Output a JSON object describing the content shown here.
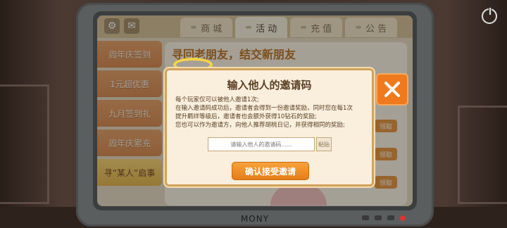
{
  "top_nav": {
    "tabs": [
      {
        "label": "商 城"
      },
      {
        "label": "活 动"
      },
      {
        "label": "充 值"
      },
      {
        "label": "公 告"
      }
    ],
    "ornament": "⇹"
  },
  "sidebar": {
    "items": [
      {
        "label": "周年庆签到"
      },
      {
        "label": "1元超优惠"
      },
      {
        "label": "九月签到礼"
      },
      {
        "label": "周年庆累充"
      },
      {
        "label": "寻“某人”启事"
      }
    ]
  },
  "main": {
    "headline": "寻回老朋友，结交新朋友",
    "mini_buttons": [
      "领取",
      "领取",
      "领取"
    ]
  },
  "dialog": {
    "title": "输入他人的邀请码",
    "body_lines": [
      "每个玩家仅可以被他人邀请1次;",
      "在输入邀请码成功后，邀请者会得到一份邀请奖励，同时您在每1次",
      "提升羁绊等级后，邀请者也会额外获得10钻石的奖励;",
      "您也可以作为邀请方，向他人推荐胡桃日记，并获得相同的奖励;"
    ],
    "input_placeholder": "请输入他人的邀请码......",
    "paste_label": "粘贴",
    "confirm_label": "确认接受邀请"
  },
  "monitor": {
    "brand": "MONY"
  }
}
